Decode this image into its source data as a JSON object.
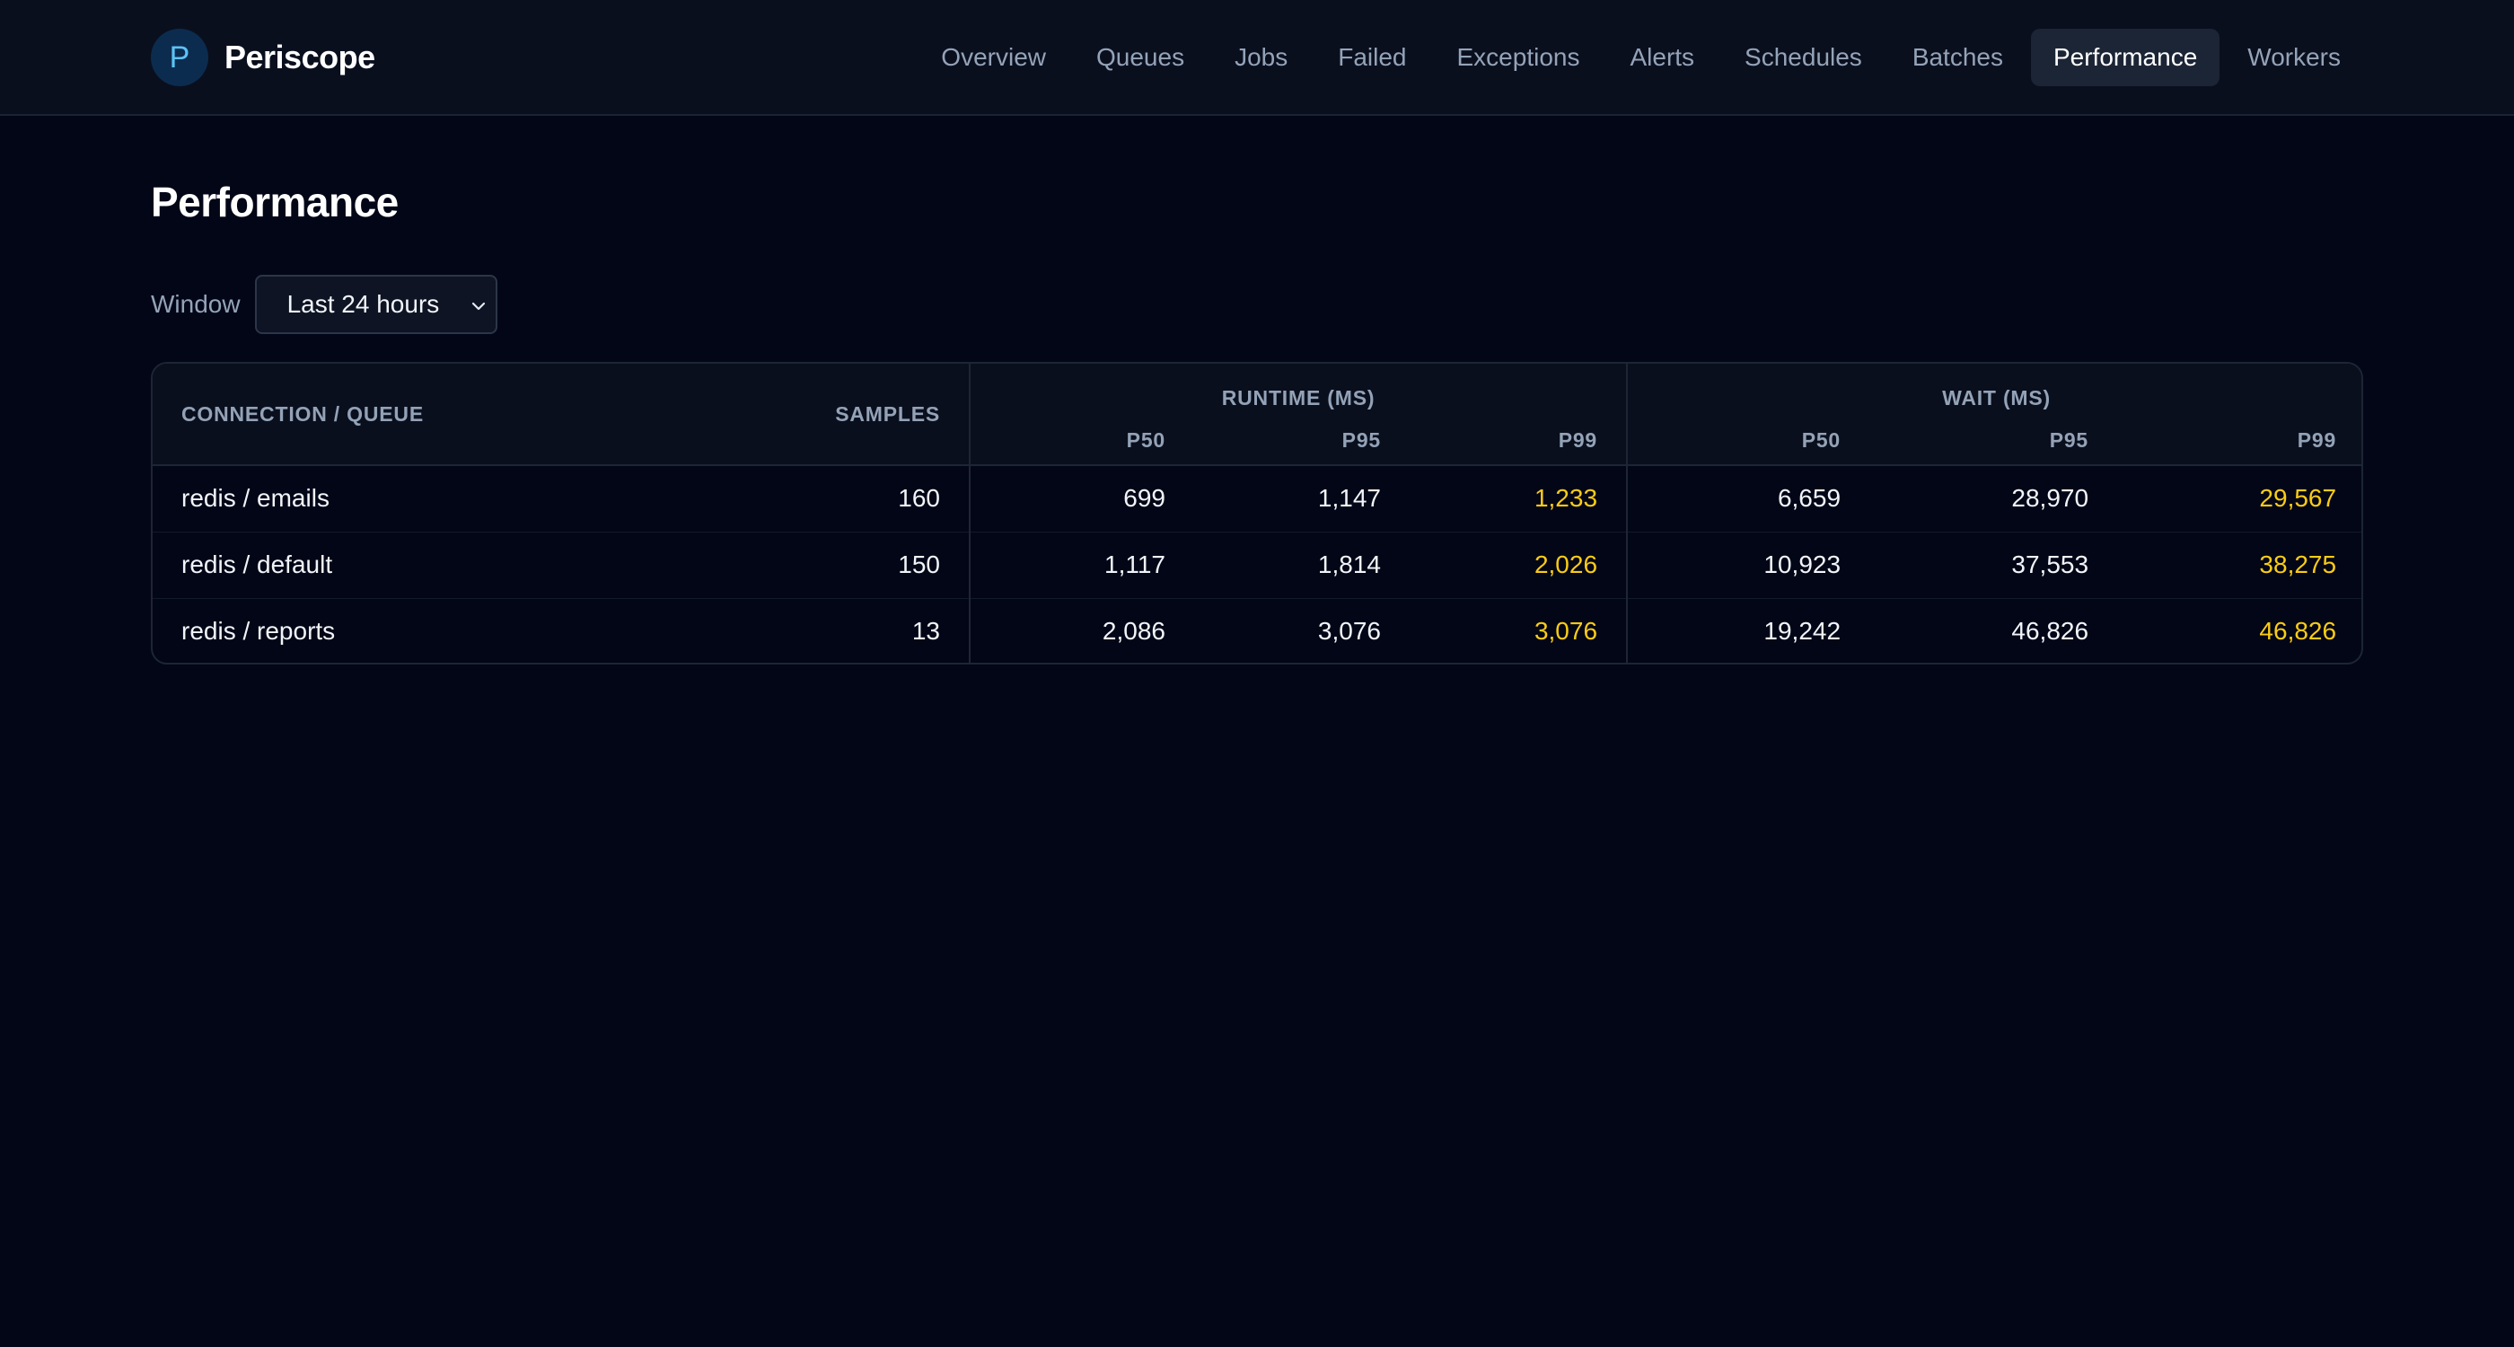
{
  "app": {
    "logo_letter": "P",
    "name": "Periscope"
  },
  "nav": [
    {
      "label": "Overview",
      "active": false
    },
    {
      "label": "Queues",
      "active": false
    },
    {
      "label": "Jobs",
      "active": false
    },
    {
      "label": "Failed",
      "active": false
    },
    {
      "label": "Exceptions",
      "active": false
    },
    {
      "label": "Alerts",
      "active": false
    },
    {
      "label": "Schedules",
      "active": false
    },
    {
      "label": "Batches",
      "active": false
    },
    {
      "label": "Performance",
      "active": true
    },
    {
      "label": "Workers",
      "active": false
    }
  ],
  "page": {
    "title": "Performance"
  },
  "window": {
    "label": "Window",
    "selected": "Last 24 hours"
  },
  "table": {
    "headers": {
      "connection": "Connection / Queue",
      "samples": "Samples",
      "runtime": "Runtime (ms)",
      "wait": "Wait (ms)",
      "p50": "P50",
      "p95": "P95",
      "p99": "P99"
    },
    "rows": [
      {
        "name": "redis / emails",
        "samples": "160",
        "runtime": [
          "699",
          "1,147",
          "1,233"
        ],
        "wait": [
          "6,659",
          "28,970",
          "29,567"
        ]
      },
      {
        "name": "redis / default",
        "samples": "150",
        "runtime": [
          "1,117",
          "1,814",
          "2,026"
        ],
        "wait": [
          "10,923",
          "37,553",
          "38,275"
        ]
      },
      {
        "name": "redis / reports",
        "samples": "13",
        "runtime": [
          "2,086",
          "3,076",
          "3,076"
        ],
        "wait": [
          "19,242",
          "46,826",
          "46,826"
        ]
      }
    ]
  },
  "colors": {
    "background": "#030617",
    "highlight": "#facc15",
    "logo": "#5cc2f5"
  }
}
